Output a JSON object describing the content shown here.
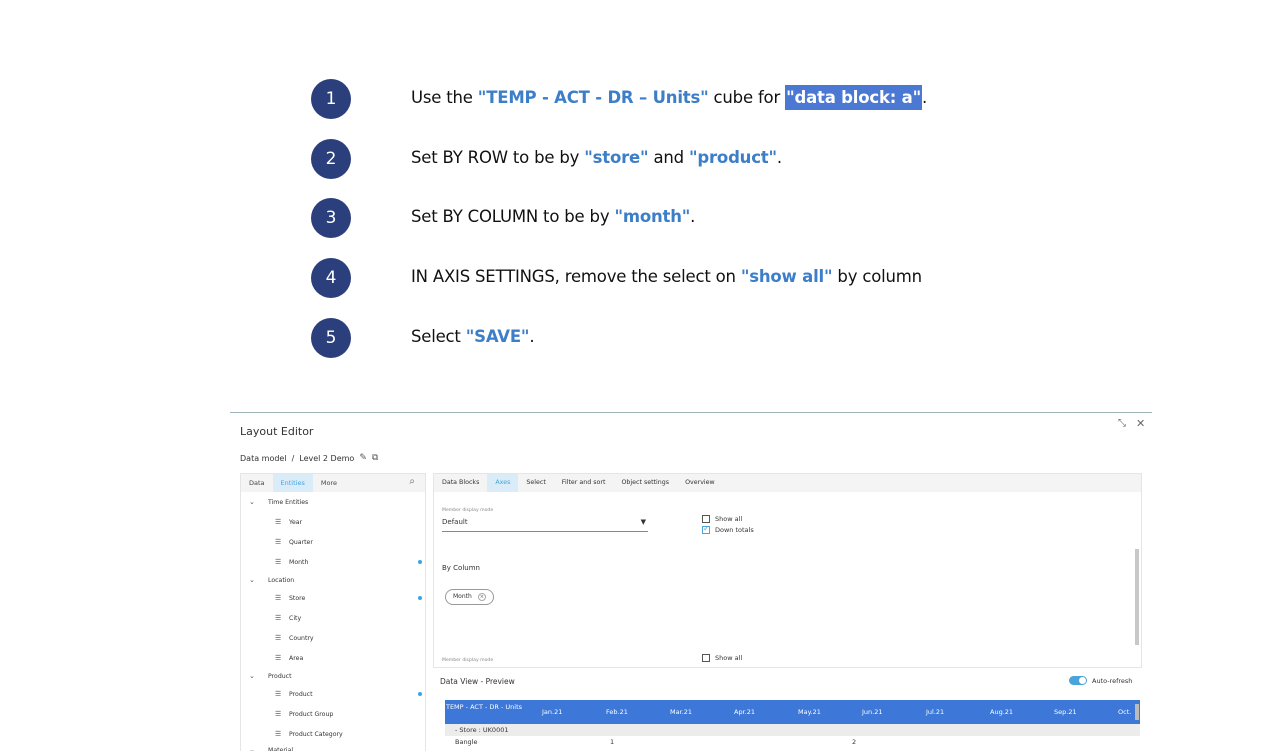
{
  "steps": [
    {
      "num": "1",
      "parts": [
        {
          "t": "Use the ",
          "s": "plain"
        },
        {
          "t": "\"TEMP - ACT - DR – Units\"",
          "s": "hl"
        },
        {
          "t": " cube for ",
          "s": "plain"
        },
        {
          "t": "\"data block: a\"",
          "s": "sel"
        },
        {
          "t": ".",
          "s": "plain"
        }
      ]
    },
    {
      "num": "2",
      "parts": [
        {
          "t": "Set BY ROW to be by ",
          "s": "plain"
        },
        {
          "t": "\"store\"",
          "s": "hl"
        },
        {
          "t": " and ",
          "s": "plain"
        },
        {
          "t": "\"product\"",
          "s": "hl"
        },
        {
          "t": ".",
          "s": "plain"
        }
      ]
    },
    {
      "num": "3",
      "parts": [
        {
          "t": "Set BY COLUMN to be by ",
          "s": "plain"
        },
        {
          "t": "\"month\"",
          "s": "hl"
        },
        {
          "t": ".",
          "s": "plain"
        }
      ]
    },
    {
      "num": "4",
      "parts": [
        {
          "t": "IN AXIS SETTINGS, remove the select on ",
          "s": "plain"
        },
        {
          "t": "\"show all\"",
          "s": "hl"
        },
        {
          "t": " by column",
          "s": "plain"
        }
      ]
    },
    {
      "num": "5",
      "parts": [
        {
          "t": "Select ",
          "s": "plain"
        },
        {
          "t": "\"SAVE\"",
          "s": "hl"
        },
        {
          "t": ".",
          "s": "plain"
        }
      ]
    }
  ],
  "editor": {
    "title": "Layout Editor",
    "breadcrumb": {
      "root": "Data model",
      "sep": "/",
      "current": "Level 2 Demo"
    },
    "left_tabs": [
      {
        "label": "Data",
        "active": false
      },
      {
        "label": "Entities",
        "active": true
      },
      {
        "label": "More",
        "active": false
      }
    ],
    "tree": [
      {
        "label": "Time Entities",
        "level": 0,
        "dot": false
      },
      {
        "label": "Year",
        "level": 1,
        "dot": false
      },
      {
        "label": "Quarter",
        "level": 1,
        "dot": false
      },
      {
        "label": "Month",
        "level": 1,
        "dot": true
      },
      {
        "label": "Location",
        "level": 0,
        "dot": false
      },
      {
        "label": "Store",
        "level": 1,
        "dot": true
      },
      {
        "label": "City",
        "level": 1,
        "dot": false
      },
      {
        "label": "Country",
        "level": 1,
        "dot": false
      },
      {
        "label": "Area",
        "level": 1,
        "dot": false
      },
      {
        "label": "Product",
        "level": 0,
        "dot": false
      },
      {
        "label": "Product",
        "level": 1,
        "dot": true
      },
      {
        "label": "Product Group",
        "level": 1,
        "dot": false
      },
      {
        "label": "Product Category",
        "level": 1,
        "dot": false
      },
      {
        "label": "Material",
        "level": 0,
        "dot": false
      }
    ],
    "right_tabs": [
      {
        "label": "Data Blocks",
        "active": false
      },
      {
        "label": "Axes",
        "active": true
      },
      {
        "label": "Select",
        "active": false
      },
      {
        "label": "Filter and sort",
        "active": false
      },
      {
        "label": "Object settings",
        "active": false
      },
      {
        "label": "Overview",
        "active": false
      }
    ],
    "member_display_label": "Member display mode",
    "member_display_value": "Default",
    "show_all_label": "Show all",
    "show_all_checked": false,
    "down_totals_label": "Down totals",
    "down_totals_checked": true,
    "by_column_label": "By Column",
    "chip_label": "Month",
    "member_display_label_2": "Member display mode",
    "show_all_label_2": "Show all",
    "preview_title": "Data View - Preview",
    "auto_refresh_label": "Auto-refresh",
    "grid": {
      "corner": "TEMP - ACT - DR - Units",
      "columns": [
        "Jan.21",
        "Feb.21",
        "Mar.21",
        "Apr.21",
        "May.21",
        "Jun.21",
        "Jul.21",
        "Aug.21",
        "Sep.21",
        "Oct."
      ],
      "group_row": "- Store : UK0001",
      "row_label": "Bangle",
      "row_values": [
        "",
        "1",
        "",
        "",
        "",
        "2",
        "",
        "",
        "",
        ""
      ]
    }
  }
}
